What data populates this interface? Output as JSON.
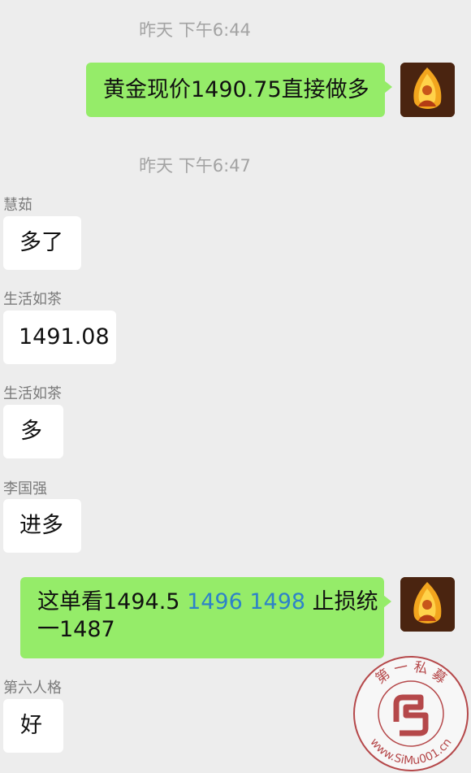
{
  "colors": {
    "background": "#ededed",
    "outgoing_bubble": "#95ec69",
    "incoming_bubble": "#ffffff",
    "link": "#2d82c9",
    "watermark": "#b5484a"
  },
  "timestamps": [
    "昨天  下午6:44",
    "昨天  下午6:47"
  ],
  "messages": [
    {
      "direction": "out",
      "text": "黄金现价1490.75直接做多"
    },
    {
      "direction": "in",
      "sender": "慧茹",
      "text": "多了"
    },
    {
      "direction": "in",
      "sender": "生活如茶",
      "text": "1491.08"
    },
    {
      "direction": "in",
      "sender": "生活如茶",
      "text": "多"
    },
    {
      "direction": "in",
      "sender": "李国强",
      "text": "进多"
    },
    {
      "direction": "out",
      "text_before": "这单看1494.5 ",
      "text_links": "1496 1498",
      "text_after": " 止损统",
      "text_line2": "一1487"
    },
    {
      "direction": "in",
      "sender": "第六人格",
      "text": "好"
    }
  ],
  "watermark": {
    "top_text": "第 一 私 募",
    "url": "www.SiMu001.cn"
  },
  "icons": {
    "avatar": "avatar-icon",
    "watermark_logo": "watermark-logo-icon"
  }
}
